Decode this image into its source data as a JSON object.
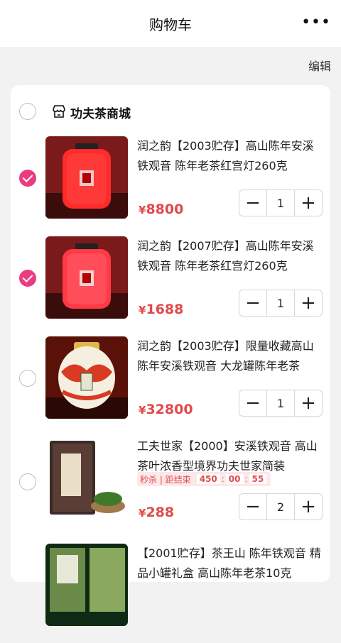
{
  "header": {
    "title": "购物车",
    "more": "•••"
  },
  "edit_label": "编辑",
  "shop": {
    "name": "功夫茶商城",
    "icon": "store-icon"
  },
  "items": [
    {
      "name": "润之韵【2003贮存】高山陈年安溪铁观音 陈年老茶红宫灯260克",
      "price_currency": "¥",
      "price": "8800",
      "qty": "1",
      "checked": true
    },
    {
      "name": "润之韵【2007贮存】高山陈年安溪铁观音 陈年老茶红宫灯260克",
      "price_currency": "¥",
      "price": "1688",
      "qty": "1",
      "checked": true
    },
    {
      "name": "润之韵【2003贮存】限量收藏高山陈年安溪铁观音 大龙罐陈年老茶",
      "price_currency": "¥",
      "price": "32800",
      "qty": "1",
      "checked": false
    },
    {
      "name": "工夫世家【2000】安溪铁观音 高山茶叶浓香型境界功夫世家简装",
      "price_currency": "¥",
      "price": "288",
      "qty": "2",
      "checked": false,
      "flash_sale": {
        "label": "秒杀 | 距结束",
        "h": "450",
        "m": "00",
        "s": "55"
      }
    },
    {
      "name": "【2001贮存】茶王山 陈年铁观音 精品小罐礼盒 高山陈年老茶10克",
      "price_currency": "¥",
      "price": "",
      "qty": "",
      "checked": false
    }
  ],
  "stepper": {
    "minus": "−",
    "plus": "+"
  },
  "colors": {
    "accent": "#ea3d7f",
    "price": "#e04a4a"
  }
}
